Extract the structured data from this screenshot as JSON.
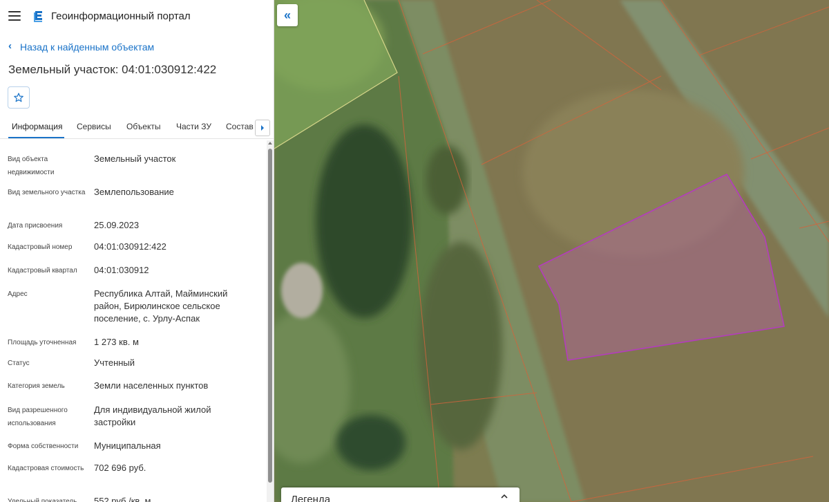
{
  "header": {
    "app_title": "Геоинформационный портал",
    "menu_icon": "hamburger-menu-icon",
    "logo_icon": "portal-logo-icon"
  },
  "nav": {
    "back_label": "Назад к найденным объектам",
    "back_icon": "chevron-left-icon"
  },
  "object": {
    "title": "Земельный участок: 04:01:030912:422",
    "favorite_icon": "star-outline-icon"
  },
  "tabs": [
    {
      "label": "Информация",
      "active": true
    },
    {
      "label": "Сервисы",
      "active": false
    },
    {
      "label": "Объекты",
      "active": false
    },
    {
      "label": "Части ЗУ",
      "active": false
    },
    {
      "label": "Состав",
      "active": false
    }
  ],
  "tabs_scroll_icon": "chevron-right-icon",
  "info": [
    {
      "label": "Вид объекта недвижимости",
      "value": "Земельный участок"
    },
    {
      "label": "Вид земельного участка",
      "value": "Землепользование"
    },
    {
      "label": "Дата присвоения",
      "value": "25.09.2023"
    },
    {
      "label": "Кадастровый номер",
      "value": "04:01:030912:422"
    },
    {
      "label": "Кадастровый квартал",
      "value": "04:01:030912"
    },
    {
      "label": "Адрес",
      "value": "Республика Алтай, Майминский район, Бирюлинское сельское поселение, с. Урлу-Аспак"
    },
    {
      "label": "Площадь уточненная",
      "value": "1 273 кв. м"
    },
    {
      "label": "Статус",
      "value": "Учтенный"
    },
    {
      "label": "Категория земель",
      "value": "Земли населенных пунктов"
    },
    {
      "label": "Вид разрешенного использования",
      "value": "Для индивидуальной жилой застройки"
    },
    {
      "label": "Форма собственности",
      "value": "Муниципальная"
    },
    {
      "label": "Кадастровая стоимость",
      "value": "702 696 руб."
    },
    {
      "label": "Удельный показатель",
      "value": "552 руб./кв. м"
    }
  ],
  "map": {
    "collapse_icon": "double-chevron-left-icon",
    "legend_title": "Легенда",
    "legend_icon": "chevron-up-icon",
    "parcel_highlight_color": "#b43cbe",
    "boundary_color": "#d2643c"
  },
  "colors": {
    "accent": "#1a73c8"
  }
}
